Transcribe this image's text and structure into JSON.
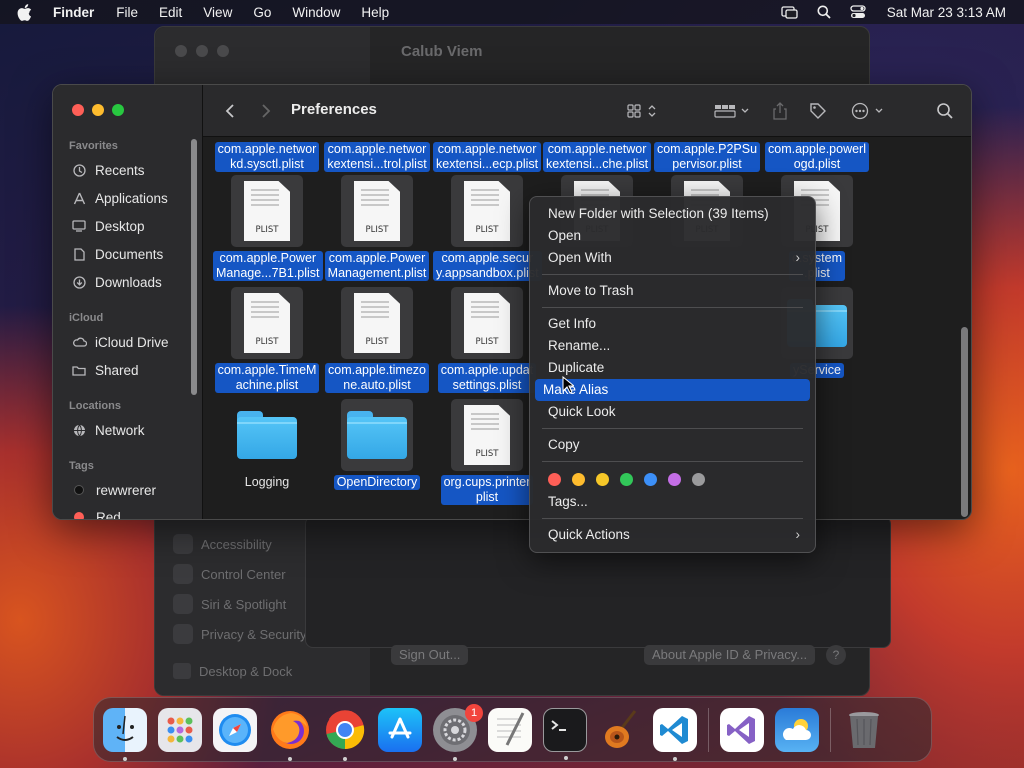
{
  "menubar": {
    "app_name": "Finder",
    "menus": [
      "File",
      "Edit",
      "View",
      "Go",
      "Window",
      "Help"
    ],
    "clock": "Sat Mar 23  3:13 AM",
    "icons": [
      "apple-icon",
      "screen-mirroring-icon",
      "spotlight-search-icon",
      "control-center-icon"
    ]
  },
  "background_window": {
    "title": "Calub Viem",
    "sidebar_items": [
      "Accessibility",
      "Control Center",
      "Siri & Spotlight",
      "Privacy & Security"
    ],
    "dock_item": "Desktop & Dock",
    "buttons": {
      "sign_out": "Sign Out...",
      "about": "About Apple ID & Privacy...",
      "help": "?"
    }
  },
  "finder": {
    "title": "Preferences",
    "sidebar": {
      "favorites_header": "Favorites",
      "favorites": [
        {
          "label": "Recents",
          "icon": "clock-icon"
        },
        {
          "label": "Applications",
          "icon": "applications-icon"
        },
        {
          "label": "Desktop",
          "icon": "desktop-icon"
        },
        {
          "label": "Documents",
          "icon": "document-icon"
        },
        {
          "label": "Downloads",
          "icon": "download-icon"
        }
      ],
      "icloud_header": "iCloud",
      "icloud": [
        {
          "label": "iCloud Drive",
          "icon": "cloud-icon"
        },
        {
          "label": "Shared",
          "icon": "shared-folder-icon"
        }
      ],
      "locations_header": "Locations",
      "locations": [
        {
          "label": "Network",
          "icon": "network-globe-icon"
        }
      ],
      "tags_header": "Tags",
      "tags": [
        {
          "label": "rewwrerer",
          "color": "#1c1c1e"
        },
        {
          "label": "Red",
          "color": "#fe5f57"
        }
      ]
    },
    "files": {
      "row0": [
        "com.apple.networ\nkd.sysctl.plist",
        "com.apple.networ\nkextensi...trol.plist",
        "com.apple.networ\nkextensi...ecp.plist",
        "com.apple.networ\nkextensi...che.plist",
        "com.apple.P2PSu\npervisor.plist",
        "com.apple.powerl\nogd.plist"
      ],
      "row1": [
        "com.apple.Power\nManage...7B1.plist",
        "com.apple.Power\nManagement.plist",
        "com.apple.secur\ny.appsandbox.plist",
        "e.system\n.plist"
      ],
      "row2": [
        "com.apple.TimeM\nachine.plist",
        "com.apple.timezo\nne.auto.plist",
        "com.apple.updat\nsettings.plist",
        "yService"
      ],
      "row3": [
        "Logging",
        "OpenDirectory",
        "org.cups.printer\nplist"
      ],
      "plist_label": "PLIST"
    }
  },
  "context_menu": {
    "items": [
      "New Folder with Selection (39 Items)",
      "Open",
      "Open With",
      "Move to Trash",
      "Get Info",
      "Rename...",
      "Duplicate",
      "Make Alias",
      "Quick Look",
      "Copy",
      "Tags...",
      "Quick Actions"
    ],
    "highlighted": "Make Alias",
    "tag_colors": [
      "#fe5f57",
      "#febc2e",
      "#f6c728",
      "#32c759",
      "#3c8ff7",
      "#c46ee6",
      "#9a9a9c"
    ]
  },
  "dock": {
    "apps": [
      "finder-icon",
      "launchpad-icon",
      "safari-icon",
      "firefox-icon",
      "chrome-icon",
      "app-store-icon",
      "system-settings-icon",
      "textedit-icon",
      "terminal-icon",
      "garageband-icon",
      "vscode-icon",
      "visual-studio-icon",
      "weather-icon",
      "trash-icon"
    ],
    "settings_badge": "1"
  }
}
